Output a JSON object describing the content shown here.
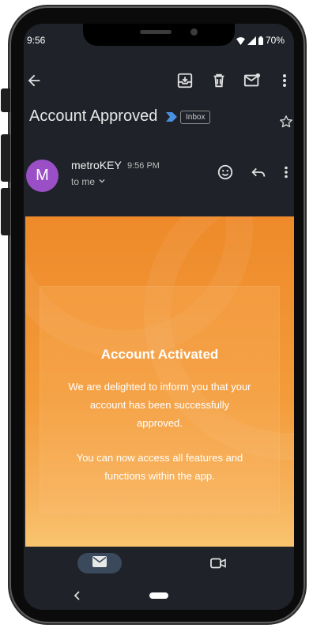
{
  "status_bar": {
    "time": "9:56",
    "battery": "70%"
  },
  "toolbar": {
    "back": "arrow-left-icon",
    "archive": "archive-icon",
    "delete": "trash-icon",
    "mark_unread": "mail-unread-icon",
    "more": "more-vert-icon"
  },
  "email": {
    "subject": "Account Approved",
    "label": "Inbox",
    "sender_initial": "M",
    "sender": "metroKEY",
    "time": "9:56 PM",
    "recipient": "to me"
  },
  "message": {
    "title": "Account Activated",
    "line1": "We are delighted to inform you that your",
    "line2": "account has been successfully",
    "line3": "approved.",
    "line4": "You can now access all features and",
    "line5": "functions within the app."
  },
  "colors": {
    "screen_bg": "#1f2329",
    "avatar": "#9b4fc7",
    "banner_orange": "#ee8a2a",
    "label_arrow": "#4a90e2"
  }
}
